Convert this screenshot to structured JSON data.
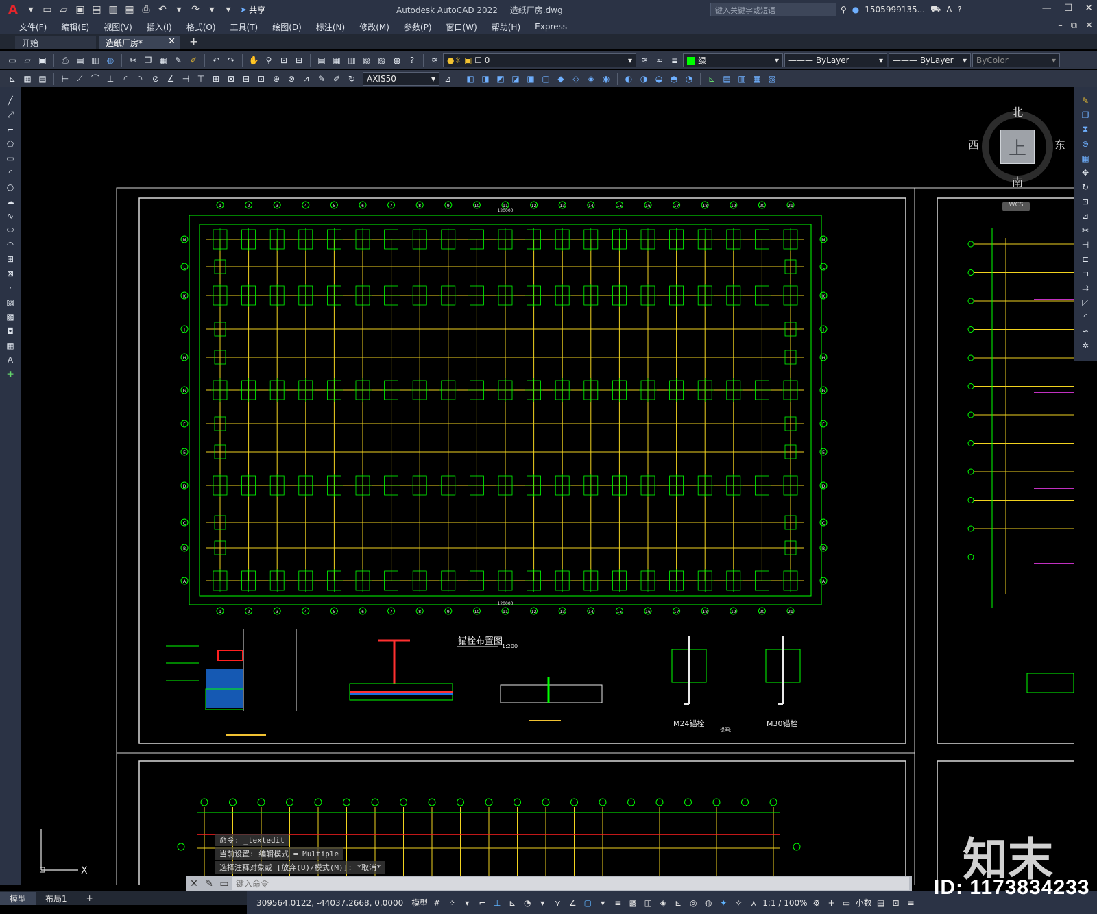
{
  "app": {
    "title": "Autodesk AutoCAD 2022",
    "file": "造纸厂房.dwg",
    "share_label": "共享",
    "search_placeholder": "键入关键字或短语",
    "user": "1505999135...",
    "logo": "A"
  },
  "menu": [
    "文件(F)",
    "编辑(E)",
    "视图(V)",
    "插入(I)",
    "格式(O)",
    "工具(T)",
    "绘图(D)",
    "标注(N)",
    "修改(M)",
    "参数(P)",
    "窗口(W)",
    "帮助(H)",
    "Express"
  ],
  "tabs": [
    {
      "label": "开始"
    },
    {
      "label": "造纸厂房*",
      "active": true
    }
  ],
  "properties": {
    "layer": "0",
    "color": "绿",
    "linetype": "ByLayer",
    "lineweight": "ByLayer",
    "plotstyle": "ByColor",
    "dimstyle": "AXIS50",
    "accent_green": "#00ff00"
  },
  "viewcube": {
    "north": "北",
    "south": "南",
    "west": "西",
    "east": "东",
    "top": "上",
    "wcs": "WCS"
  },
  "drawing": {
    "plan_title": "锚栓布置图",
    "plan_scale": "1:200",
    "dim_total": "120000",
    "bolt_m24": "M24锚栓",
    "bolt_m30": "M30锚栓",
    "note_label": "说明:",
    "row_labels": [
      "M",
      "L",
      "K",
      "J",
      "H",
      "G",
      "F",
      "E",
      "D",
      "C",
      "B",
      "A"
    ],
    "col_labels": [
      "1",
      "2",
      "3",
      "4",
      "5",
      "6",
      "7",
      "8",
      "9",
      "10",
      "11",
      "12",
      "13",
      "14",
      "15",
      "16",
      "17",
      "18",
      "19",
      "20",
      "21"
    ]
  },
  "command": {
    "lines": [
      "命令: _textedit",
      "当前设置: 编辑模式 = Multiple",
      "选择注释对象或 [放弃(U)/模式(M)]: *取消*"
    ],
    "input_placeholder": "键入命令"
  },
  "layouts": [
    "模型",
    "布局1"
  ],
  "status": {
    "coords": "309564.0122, -44037.2668, 0.0000",
    "space": "模型",
    "scale": "1:1 / 100%",
    "units": "小数"
  },
  "watermark": {
    "logo_text": "知末",
    "id_text": "ID: 1173834233"
  }
}
